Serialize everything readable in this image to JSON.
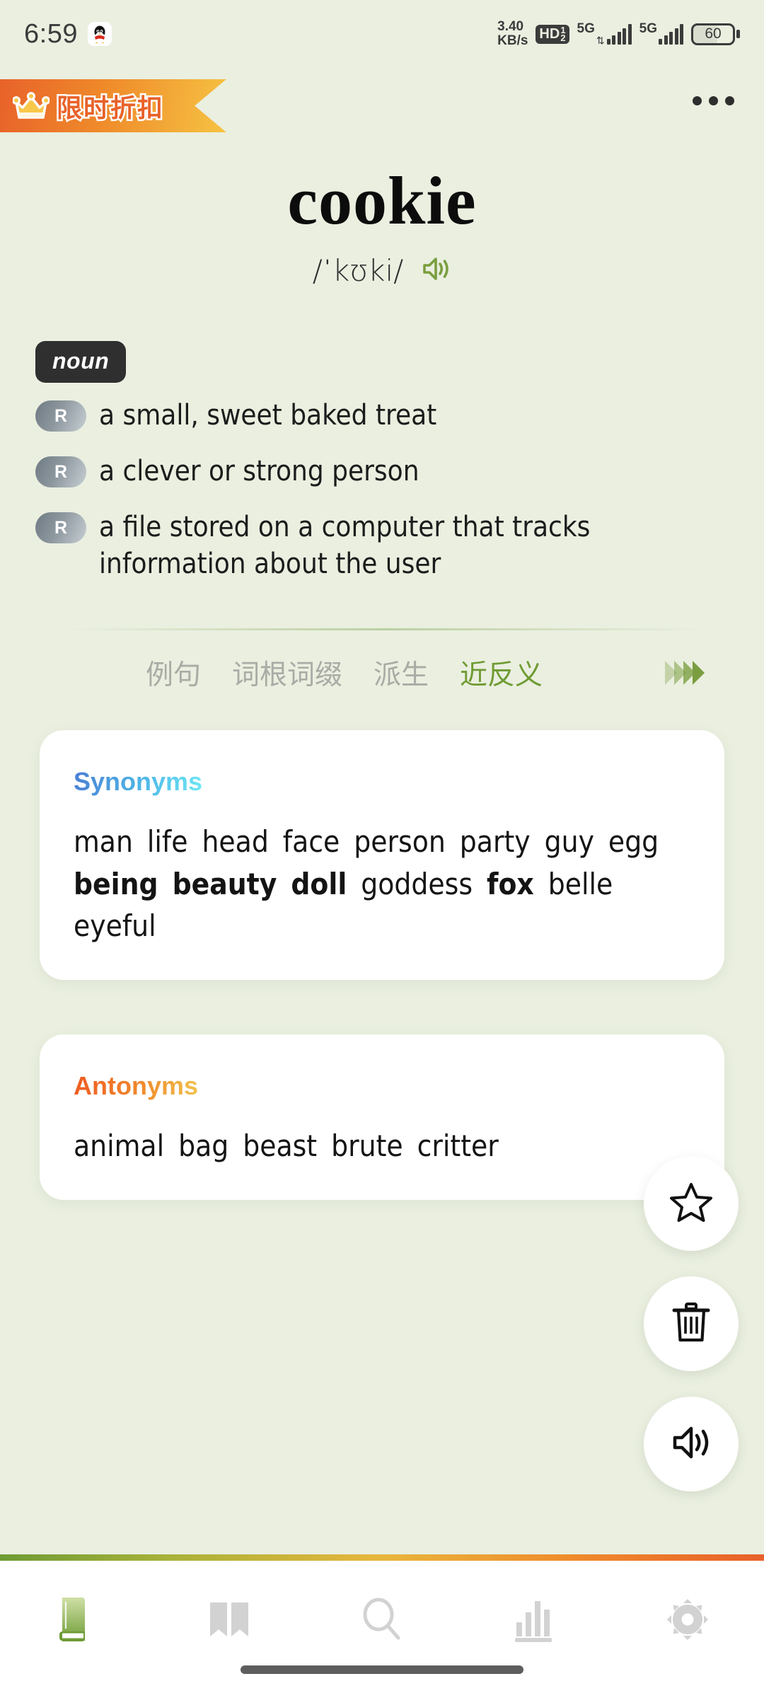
{
  "statusbar": {
    "time": "6:59",
    "app_icon": "qq-penguin-icon",
    "net_speed_value": "3.40",
    "net_speed_unit": "KB/s",
    "hd_label": "HD",
    "hd_sub_top": "1",
    "hd_sub_bottom": "2",
    "sim1_network": "5G",
    "sim2_network": "5G",
    "battery_level": "60"
  },
  "promo": {
    "label": "限时折扣",
    "icon": "crown-icon",
    "gradient_start": "#e8622a",
    "gradient_end": "#f6c343"
  },
  "header": {
    "overflow_menu": "more-options-icon"
  },
  "entry": {
    "word": "cookie",
    "phonetic": "/ˈkʊki/",
    "pronounce_icon": "speaker-icon",
    "pronounce_color": "#7a9e3f",
    "part_of_speech": "noun",
    "definitions": [
      {
        "badge": "R",
        "text": "a small, sweet baked treat"
      },
      {
        "badge": "R",
        "text": "a clever or strong person"
      },
      {
        "badge": "R",
        "text": "a file stored on a computer that tracks information about the user"
      }
    ]
  },
  "tabs": {
    "items": [
      {
        "label": "例句",
        "active": false
      },
      {
        "label": "词根词缀",
        "active": false
      },
      {
        "label": "派生",
        "active": false
      },
      {
        "label": "近反义",
        "active": true
      }
    ],
    "more_icon": "chevrons-right-icon",
    "active_color": "#6f9b33",
    "inactive_color": "#a9aca5"
  },
  "synonyms": {
    "title": "Synonyms",
    "title_gradient": [
      "#4a7fd4",
      "#6fe9f5"
    ],
    "words_html": "man life head face person party guy egg <b>being</b> <b>beauty</b> <b>doll</b> goddess <b>fox</b> belle eyeful",
    "words": [
      "man",
      "life",
      "head",
      "face",
      "person",
      "party",
      "guy",
      "egg",
      "being",
      "beauty",
      "doll",
      "goddess",
      "fox",
      "belle",
      "eyeful"
    ],
    "emphasized": [
      "being",
      "beauty",
      "doll",
      "fox"
    ]
  },
  "antonyms": {
    "title": "Antonyms",
    "title_gradient": [
      "#ee5a22",
      "#f0c44e"
    ],
    "words_html": "animal bag beast brute critter",
    "words": [
      "animal",
      "bag",
      "beast",
      "brute",
      "critter"
    ],
    "emphasized": []
  },
  "fabs": [
    {
      "name": "favorite-button",
      "icon": "star-icon"
    },
    {
      "name": "delete-button",
      "icon": "trash-icon"
    },
    {
      "name": "pronounce-button",
      "icon": "speaker-icon"
    }
  ],
  "bottom_nav": {
    "items": [
      {
        "name": "nav-dictionary",
        "icon": "book-icon",
        "active": true
      },
      {
        "name": "nav-read",
        "icon": "open-book-icon",
        "active": false
      },
      {
        "name": "nav-search",
        "icon": "search-icon",
        "active": false
      },
      {
        "name": "nav-statistics",
        "icon": "bar-chart-icon",
        "active": false
      },
      {
        "name": "nav-settings",
        "icon": "gear-icon",
        "active": false
      }
    ],
    "active_color": "#7ba83f",
    "inactive_color": "#d2d2d2"
  },
  "theme": {
    "background": "#eaefe0",
    "card_background": "#ffffff",
    "text_primary": "#141414"
  }
}
